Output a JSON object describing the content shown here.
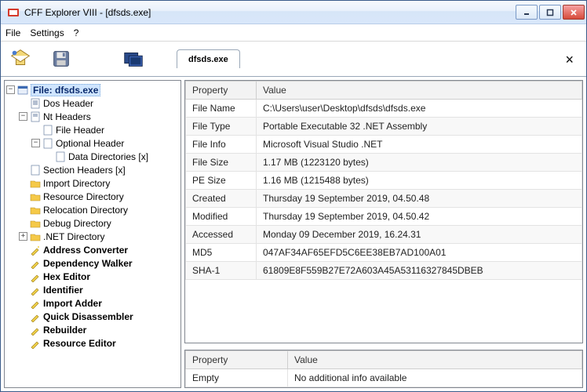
{
  "title": "CFF Explorer VIII - [dfsds.exe]",
  "menu": {
    "file": "File",
    "settings": "Settings",
    "help": "?"
  },
  "tab": {
    "label": "dfsds.exe"
  },
  "tree": {
    "root": "File: dfsds.exe",
    "dos": "Dos Header",
    "nt": "Nt Headers",
    "fileh": "File Header",
    "opth": "Optional Header",
    "datadir": "Data Directories [x]",
    "sect": "Section Headers [x]",
    "imp": "Import Directory",
    "res": "Resource Directory",
    "reloc": "Relocation Directory",
    "debug": "Debug Directory",
    "dotnet": ".NET Directory",
    "addr": "Address Converter",
    "dep": "Dependency Walker",
    "hex": "Hex Editor",
    "ident": "Identifier",
    "impadd": "Import Adder",
    "quick": "Quick Disassembler",
    "reb": "Rebuilder",
    "resed": "Resource Editor"
  },
  "grid1": {
    "h1": "Property",
    "h2": "Value",
    "rows": [
      {
        "k": "File Name",
        "v": "C:\\Users\\user\\Desktop\\dfsds\\dfsds.exe"
      },
      {
        "k": "File Type",
        "v": "Portable Executable 32 .NET Assembly"
      },
      {
        "k": "File Info",
        "v": "Microsoft Visual Studio .NET"
      },
      {
        "k": "File Size",
        "v": "1.17 MB (1223120 bytes)"
      },
      {
        "k": "PE Size",
        "v": "1.16 MB (1215488 bytes)"
      },
      {
        "k": "Created",
        "v": "Thursday 19 September 2019, 04.50.48"
      },
      {
        "k": "Modified",
        "v": "Thursday 19 September 2019, 04.50.42"
      },
      {
        "k": "Accessed",
        "v": "Monday 09 December 2019, 16.24.31"
      },
      {
        "k": "MD5",
        "v": "047AF34AF65EFD5C6EE38EB7AD100A01"
      },
      {
        "k": "SHA-1",
        "v": "61809E8F559B27E72A603A45A53116327845DBEB"
      }
    ]
  },
  "grid2": {
    "h1": "Property",
    "h2": "Value",
    "rows": [
      {
        "k": "Empty",
        "v": "No additional info available"
      }
    ]
  }
}
